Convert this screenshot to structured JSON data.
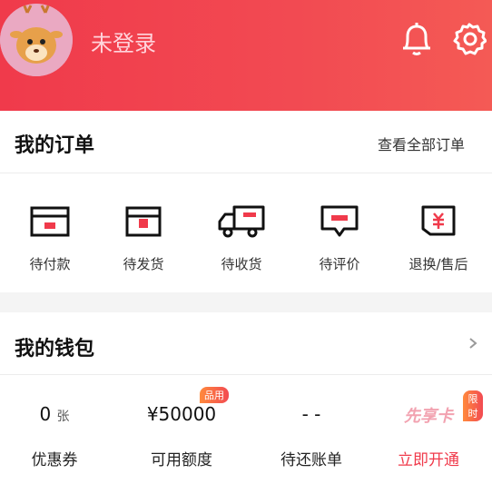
{
  "header": {
    "login_status": "未登录",
    "accent": "#f03a4b"
  },
  "orders": {
    "title": "我的订单",
    "view_all": "查看全部订单",
    "items": [
      {
        "label": "待付款",
        "icon": "card-icon"
      },
      {
        "label": "待发货",
        "icon": "box-icon"
      },
      {
        "label": "待收货",
        "icon": "truck-icon"
      },
      {
        "label": "待评价",
        "icon": "comment-icon"
      },
      {
        "label": "退换/售后",
        "icon": "refund-icon"
      }
    ]
  },
  "wallet": {
    "title": "我的钱包",
    "items": [
      {
        "value": "0",
        "unit": "张",
        "label": "优惠券"
      },
      {
        "value": "¥50000",
        "label": "可用额度",
        "badge": "品用"
      },
      {
        "value": "- -",
        "label": "待还账单"
      },
      {
        "value": "先享卡",
        "label": "立即开通",
        "badge": "限时"
      }
    ]
  }
}
